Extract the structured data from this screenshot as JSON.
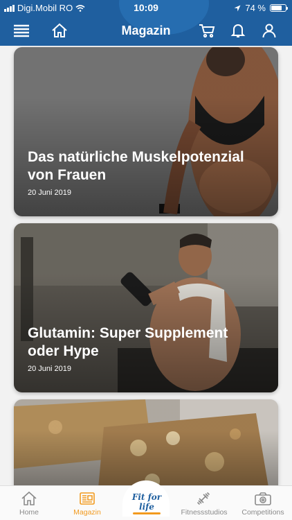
{
  "status": {
    "carrier": "Digi.Mobil RO",
    "time": "10:09",
    "battery": "74 %",
    "battery_level": 0.74
  },
  "header": {
    "title": "Magazin",
    "icons": [
      "menu-icon",
      "home-icon",
      "cart-icon",
      "bell-icon",
      "user-icon"
    ]
  },
  "articles": [
    {
      "title": "Das natürliche Muskelpotenzial von Frauen",
      "date": "20 Juni 2019"
    },
    {
      "title": "Glutamin: Super Supplement oder Hype",
      "date": "20 Juni 2019"
    },
    {
      "title": "",
      "date": ""
    }
  ],
  "tabbar": {
    "items": [
      {
        "label": "Home",
        "icon": "home-icon"
      },
      {
        "label": "Magazin",
        "icon": "magazine-icon"
      },
      {
        "label": "Fitnessstudios",
        "icon": "dumbbell-icon"
      },
      {
        "label": "Competitions",
        "icon": "camera-icon"
      }
    ],
    "logo_text": "Fit for life",
    "active": "Magazin"
  },
  "colors": {
    "header_bg": "#1f5f9f",
    "accent": "#f29a1e",
    "tab_inactive": "#8a8a8a"
  }
}
